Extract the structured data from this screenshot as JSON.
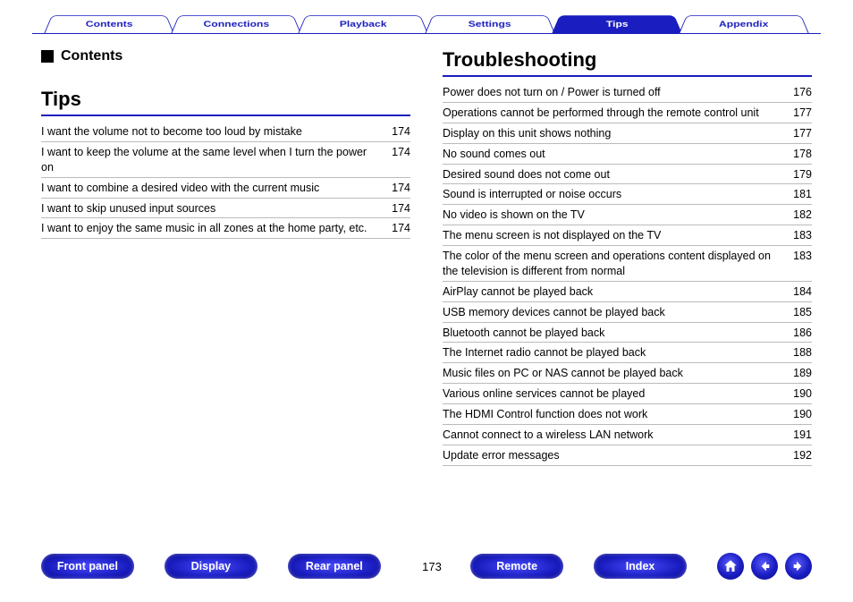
{
  "nav": {
    "tabs": [
      {
        "label": "Contents",
        "active": false
      },
      {
        "label": "Connections",
        "active": false
      },
      {
        "label": "Playback",
        "active": false
      },
      {
        "label": "Settings",
        "active": false
      },
      {
        "label": "Tips",
        "active": true
      },
      {
        "label": "Appendix",
        "active": false
      }
    ]
  },
  "left": {
    "contents_label": "Contents",
    "heading": "Tips",
    "items": [
      {
        "text": "I want the volume not to become too loud by mistake",
        "page": "174"
      },
      {
        "text": "I want to keep the volume at the same level when I turn the power on",
        "page": "174"
      },
      {
        "text": "I want to combine a desired video with the current music",
        "page": "174"
      },
      {
        "text": "I want to skip unused input sources",
        "page": "174"
      },
      {
        "text": "I want to enjoy the same music in all zones at the home party, etc.",
        "page": "174"
      }
    ]
  },
  "right": {
    "heading": "Troubleshooting",
    "items": [
      {
        "text": "Power does not turn on / Power is turned off",
        "page": "176"
      },
      {
        "text": "Operations cannot be performed through the remote control unit",
        "page": "177"
      },
      {
        "text": "Display on this unit shows nothing",
        "page": "177"
      },
      {
        "text": "No sound comes out",
        "page": "178"
      },
      {
        "text": "Desired sound does not come out",
        "page": "179"
      },
      {
        "text": "Sound is interrupted or noise occurs",
        "page": "181"
      },
      {
        "text": "No video is shown on the TV",
        "page": "182"
      },
      {
        "text": "The menu screen is not displayed on the TV",
        "page": "183"
      },
      {
        "text": "The color of the menu screen and operations content displayed on the television is different from normal",
        "page": "183"
      },
      {
        "text": "AirPlay cannot be played back",
        "page": "184"
      },
      {
        "text": "USB memory devices cannot be played back",
        "page": "185"
      },
      {
        "text": "Bluetooth cannot be played back",
        "page": "186"
      },
      {
        "text": "The Internet radio cannot be played back",
        "page": "188"
      },
      {
        "text": "Music files on PC or NAS cannot be played back",
        "page": "189"
      },
      {
        "text": "Various online services cannot be played",
        "page": "190"
      },
      {
        "text": "The HDMI Control function does not work",
        "page": "190"
      },
      {
        "text": "Cannot connect to a wireless LAN network",
        "page": "191"
      },
      {
        "text": "Update error messages",
        "page": "192"
      }
    ]
  },
  "bottom": {
    "buttons": [
      {
        "label": "Front panel"
      },
      {
        "label": "Display"
      },
      {
        "label": "Rear panel"
      }
    ],
    "page_number": "173",
    "buttons2": [
      {
        "label": "Remote"
      },
      {
        "label": "Index"
      }
    ]
  }
}
